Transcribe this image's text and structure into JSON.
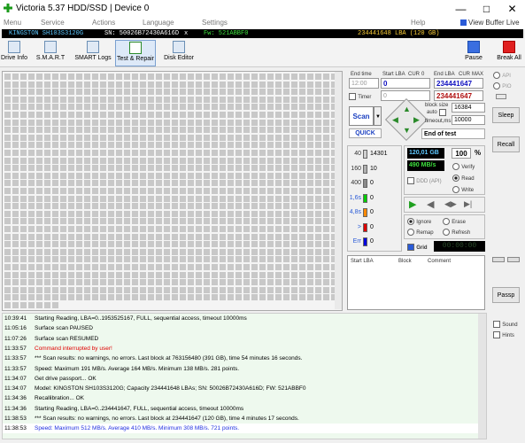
{
  "window": {
    "title": "Victoria 5.37 HDD/SSD | Device 0"
  },
  "menu": [
    "Menu",
    "Service",
    "Actions",
    "Language",
    "Settings",
    "Help"
  ],
  "view_buffer": "View Buffer Live",
  "infobar": {
    "model": "KINGSTON SH103S3120G",
    "sn": "SN: 50026B72430A616D",
    "close": "x",
    "fw": "Fw: 521ABBF0",
    "lba": "234441648 LBA (120 GB)"
  },
  "toolbar": {
    "items": [
      "Drive Info",
      "S.M.A.R.T",
      "SMART Logs",
      "Test & Repair",
      "Disk Editor"
    ],
    "pause": "Pause",
    "break": "Break All"
  },
  "timers": {
    "end_time_label": "End time",
    "start_lba_label": "Start LBA",
    "cur1": "CUR",
    "cur0": "0",
    "end_lba_label": "End LBA",
    "cur2": "CUR",
    "max": "MAX",
    "time": "12:00",
    "start_lba": "0",
    "end_lba": "234441647",
    "timer_label": "Timer",
    "timer_val": "0",
    "end_lba_val2": "234441647"
  },
  "scan": {
    "scan": "Scan",
    "quick": "QUICK",
    "block_size_label": "block size",
    "auto": "auto",
    "block_size": "16384",
    "timeout_label": "timeout,ms",
    "timeout": "10000",
    "end_test": "End of test"
  },
  "counters": [
    {
      "label": "40",
      "count": "14301",
      "color": "#d0d0d0"
    },
    {
      "label": "160",
      "count": "10",
      "color": "#b0b0b0"
    },
    {
      "label": "400",
      "count": "0",
      "color": "#8a8a8a"
    },
    {
      "label": "1,6s",
      "count": "0",
      "color": "#00cc00"
    },
    {
      "label": "4,8s",
      "count": "0",
      "color": "#ff8800"
    },
    {
      "label": ">",
      "count": "0",
      "color": "#dd0000"
    },
    {
      "label": "Err",
      "count": "0",
      "color": "#0000dd"
    }
  ],
  "stats": {
    "size": "120,01 GB",
    "pct": "100",
    "pct_sign": "%",
    "speed": "490 MB/s",
    "verify": "Verify",
    "read": "Read",
    "write": "Write",
    "ddd": "DDD (API)"
  },
  "actions": {
    "ignore": "Ignore",
    "erase": "Erase",
    "remap": "Remap",
    "refresh": "Refresh",
    "grid": "Grid",
    "clock": "00:00:00"
  },
  "table": {
    "cols": [
      "Start LBA",
      "Block",
      "Comment"
    ]
  },
  "side": {
    "api": "API",
    "pio": "PIO",
    "sleep": "Sleep",
    "recall": "Recall",
    "passp": "Passp",
    "sound": "Sound",
    "hints": "Hints"
  },
  "log": [
    {
      "t": "10:39:41",
      "m": "Starting Reading, LBA=0..1953525167, FULL, sequential access, timeout 10000ms",
      "c": "#000"
    },
    {
      "t": "11:05:16",
      "m": "Surface scan PAUSED",
      "c": "#000"
    },
    {
      "t": "11:07:26",
      "m": "Surface scan RESUMED",
      "c": "#000"
    },
    {
      "t": "11:33:57",
      "m": "Command interrupted by user!",
      "c": "#e00000"
    },
    {
      "t": "11:33:57",
      "m": "*** Scan results: no warnings, no errors. Last block at 763156480 (391 GB), time 54 minutes 16 seconds.",
      "c": "#000"
    },
    {
      "t": "11:33:57",
      "m": "Speed: Maximum 191 MB/s. Average 164 MB/s. Minimum 138 MB/s. 281 points.",
      "c": "#000"
    },
    {
      "t": "11:34:07",
      "m": "Get drive passport... OK",
      "c": "#000"
    },
    {
      "t": "11:34:07",
      "m": "Model: KINGSTON SH103S3120G; Capacity 234441648 LBAs; SN: 50026B72430A616D; FW: 521ABBF0",
      "c": "#000"
    },
    {
      "t": "11:34:36",
      "m": "Recallibration... OK",
      "c": "#000"
    },
    {
      "t": "11:34:36",
      "m": "Starting Reading, LBA=0..234441647, FULL, sequential access, timeout 10000ms",
      "c": "#000"
    },
    {
      "t": "11:38:53",
      "m": "*** Scan results: no warnings, no errors. Last block at 234441647 (120 GB), time 4 minutes 17 seconds.",
      "c": "#000"
    },
    {
      "t": "11:38:53",
      "m": "Speed: Maximum 512 MB/s. Average 410 MB/s. Minimum 308 MB/s. 721 points.",
      "c": "#2030e0"
    }
  ]
}
